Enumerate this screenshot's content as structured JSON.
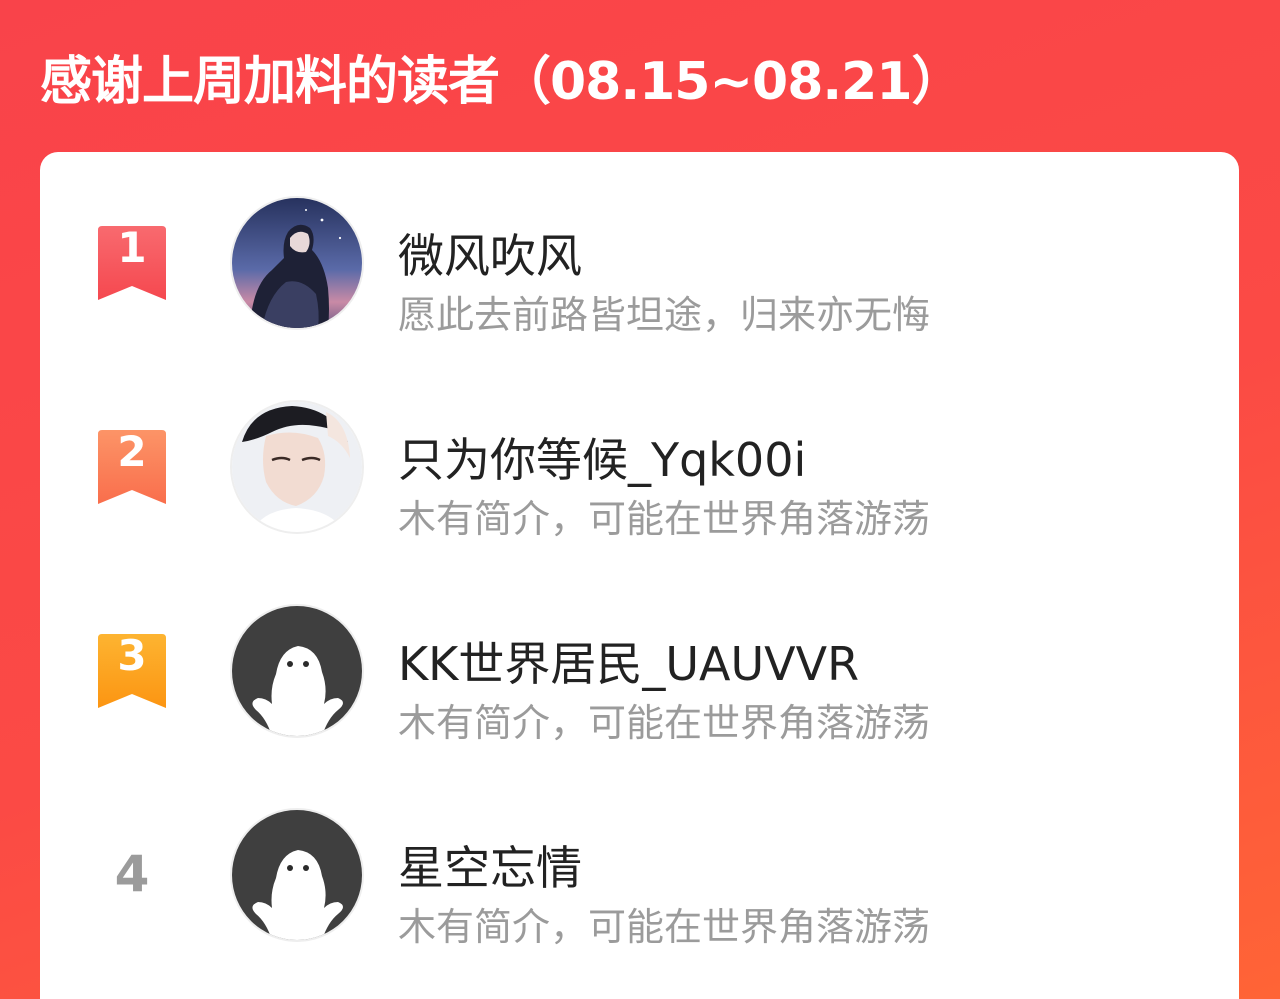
{
  "header": {
    "title": "感谢上周加料的读者（08.15~08.21）"
  },
  "colors": {
    "background_top": "#f9434a",
    "background_bottom": "#ff6436",
    "rank1": "#f8545d",
    "rank2": "#fb7f58",
    "rank3": "#fda21f",
    "rank_plain": "#9b9b9b",
    "name": "#222222",
    "bio": "#9b9b9b"
  },
  "readers": [
    {
      "rank": "1",
      "name": "微风吹风",
      "bio": "愿此去前路皆坦途，归来亦无悔",
      "avatar": "anime-night-sky-photo"
    },
    {
      "rank": "2",
      "name": "只为你等候_Yqk00i",
      "bio": "木有简介，可能在世界角落游荡",
      "avatar": "portrait-photo"
    },
    {
      "rank": "3",
      "name": "KK世界居民_UAUVVR",
      "bio": "木有简介，可能在世界角落游荡",
      "avatar": "default-avatar-icon"
    },
    {
      "rank": "4",
      "name": "星空忘情",
      "bio": "木有简介，可能在世界角落游荡",
      "avatar": "default-avatar-icon"
    }
  ]
}
